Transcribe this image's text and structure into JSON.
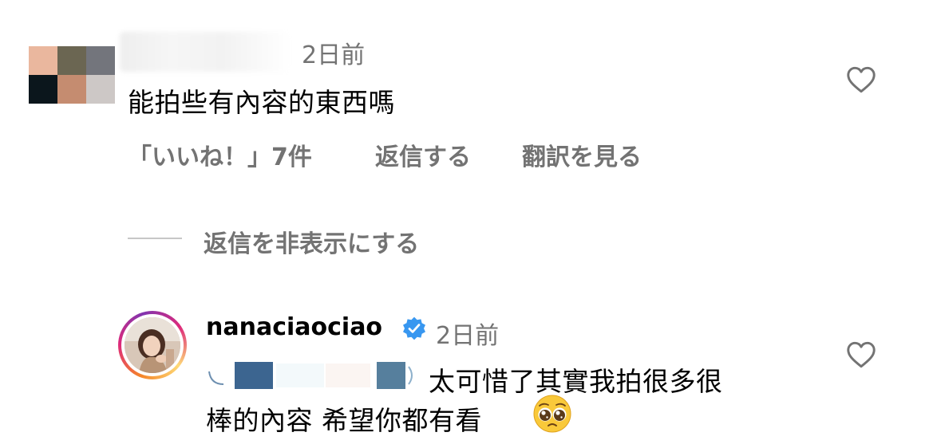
{
  "top_comment": {
    "avatar_pixels": [
      "#eab79e",
      "#6b6652",
      "#73757c",
      "#0b161c",
      "#c58c70",
      "#cdc8c6"
    ],
    "time": "2日前",
    "text": "能拍些有內容的東西嗎",
    "likes_label": "「いいね！」7件",
    "reply_label": "返信する",
    "translate_label": "翻訳を見る"
  },
  "hide_replies_label": "返信を非表示にする",
  "reply": {
    "username": "nanaciaociao",
    "verified": true,
    "time": "2日前",
    "text_line1": "太可惜了其實我拍很多很",
    "text_line2": "棒的內容 希望你都有看",
    "emoji": "pleading-face-emoji"
  },
  "colors": {
    "secondary_text": "#737373",
    "verified_blue": "#3897f0",
    "divider": "#c7c7c7"
  }
}
